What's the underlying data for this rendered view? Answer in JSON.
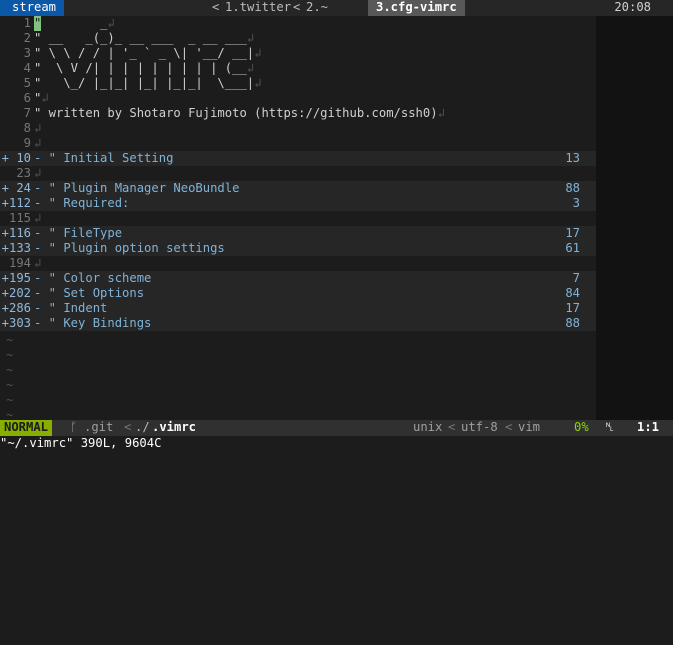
{
  "tabline": {
    "session": "stream",
    "tabs": [
      "1.twitter",
      "2.~",
      "3.cfg-vimrc"
    ],
    "active_index": 2,
    "clock": "20:08"
  },
  "editor": {
    "lines": [
      {
        "num": "1",
        "text": "\"        _",
        "kind": "code",
        "cursor": true
      },
      {
        "num": "2",
        "text": "\" __   _(_)_ __ ___  _ __ ___",
        "kind": "code"
      },
      {
        "num": "3",
        "text": "\" \\ \\ / / | '_ ` _ \\| '__/ __|",
        "kind": "code"
      },
      {
        "num": "4",
        "text": "\"  \\ V /| | | | | | | | | (__",
        "kind": "code"
      },
      {
        "num": "5",
        "text": "\"   \\_/ |_|_| |_| |_|_|  \\___|",
        "kind": "code"
      },
      {
        "num": "6",
        "text": "\"",
        "kind": "code"
      },
      {
        "num": "7",
        "text": "\" written by Shotaro Fujimoto (https://github.com/ssh0)",
        "kind": "code"
      },
      {
        "num": "8",
        "text": "",
        "kind": "code"
      },
      {
        "num": "9",
        "text": "",
        "kind": "code"
      },
      {
        "num": "+ 10",
        "text": "- \" Initial Setting",
        "count": "13",
        "kind": "fold"
      },
      {
        "num": "23",
        "text": "",
        "kind": "code"
      },
      {
        "num": "+ 24",
        "text": "- \" Plugin Manager NeoBundle",
        "count": "88",
        "kind": "fold"
      },
      {
        "num": "+112",
        "text": "- \" Required:",
        "count": "3",
        "kind": "fold"
      },
      {
        "num": "115",
        "text": "",
        "kind": "code"
      },
      {
        "num": "+116",
        "text": "- \" FileType",
        "count": "17",
        "kind": "fold"
      },
      {
        "num": "+133",
        "text": "- \" Plugin option settings",
        "count": "61",
        "kind": "fold"
      },
      {
        "num": "194",
        "text": "",
        "kind": "code"
      },
      {
        "num": "+195",
        "text": "- \" Color scheme",
        "count": "7",
        "kind": "fold"
      },
      {
        "num": "+202",
        "text": "- \" Set Options",
        "count": "84",
        "kind": "fold"
      },
      {
        "num": "+286",
        "text": "- \" Indent",
        "count": "17",
        "kind": "fold"
      },
      {
        "num": "+303",
        "text": "- \" Key Bindings",
        "count": "88",
        "kind": "fold"
      }
    ],
    "eol_glyph": "↲",
    "tilde_glyph": "~",
    "tilde_count": 6
  },
  "statusline": {
    "mode": "NORMAL",
    "branch_icon": "branch-icon",
    "branch_glyph": "ᚴ",
    "git": ".git",
    "path_prefix": "./",
    "filename": ".vimrc",
    "fileformat": "unix",
    "encoding": "utf-8",
    "filetype": "vim",
    "percent": "0%",
    "line_icon": "line-number-icon",
    "line_glyph": "␤",
    "position": "1:1",
    "separator": "<"
  },
  "cmdline": {
    "message": "\"~/.vimrc\" 390L, 9604C"
  },
  "colors": {
    "mode_bg": "#87af00",
    "session_bg": "#0b58a8",
    "fold_text": "#7fb3d8",
    "cursor": "#7ec27e"
  }
}
